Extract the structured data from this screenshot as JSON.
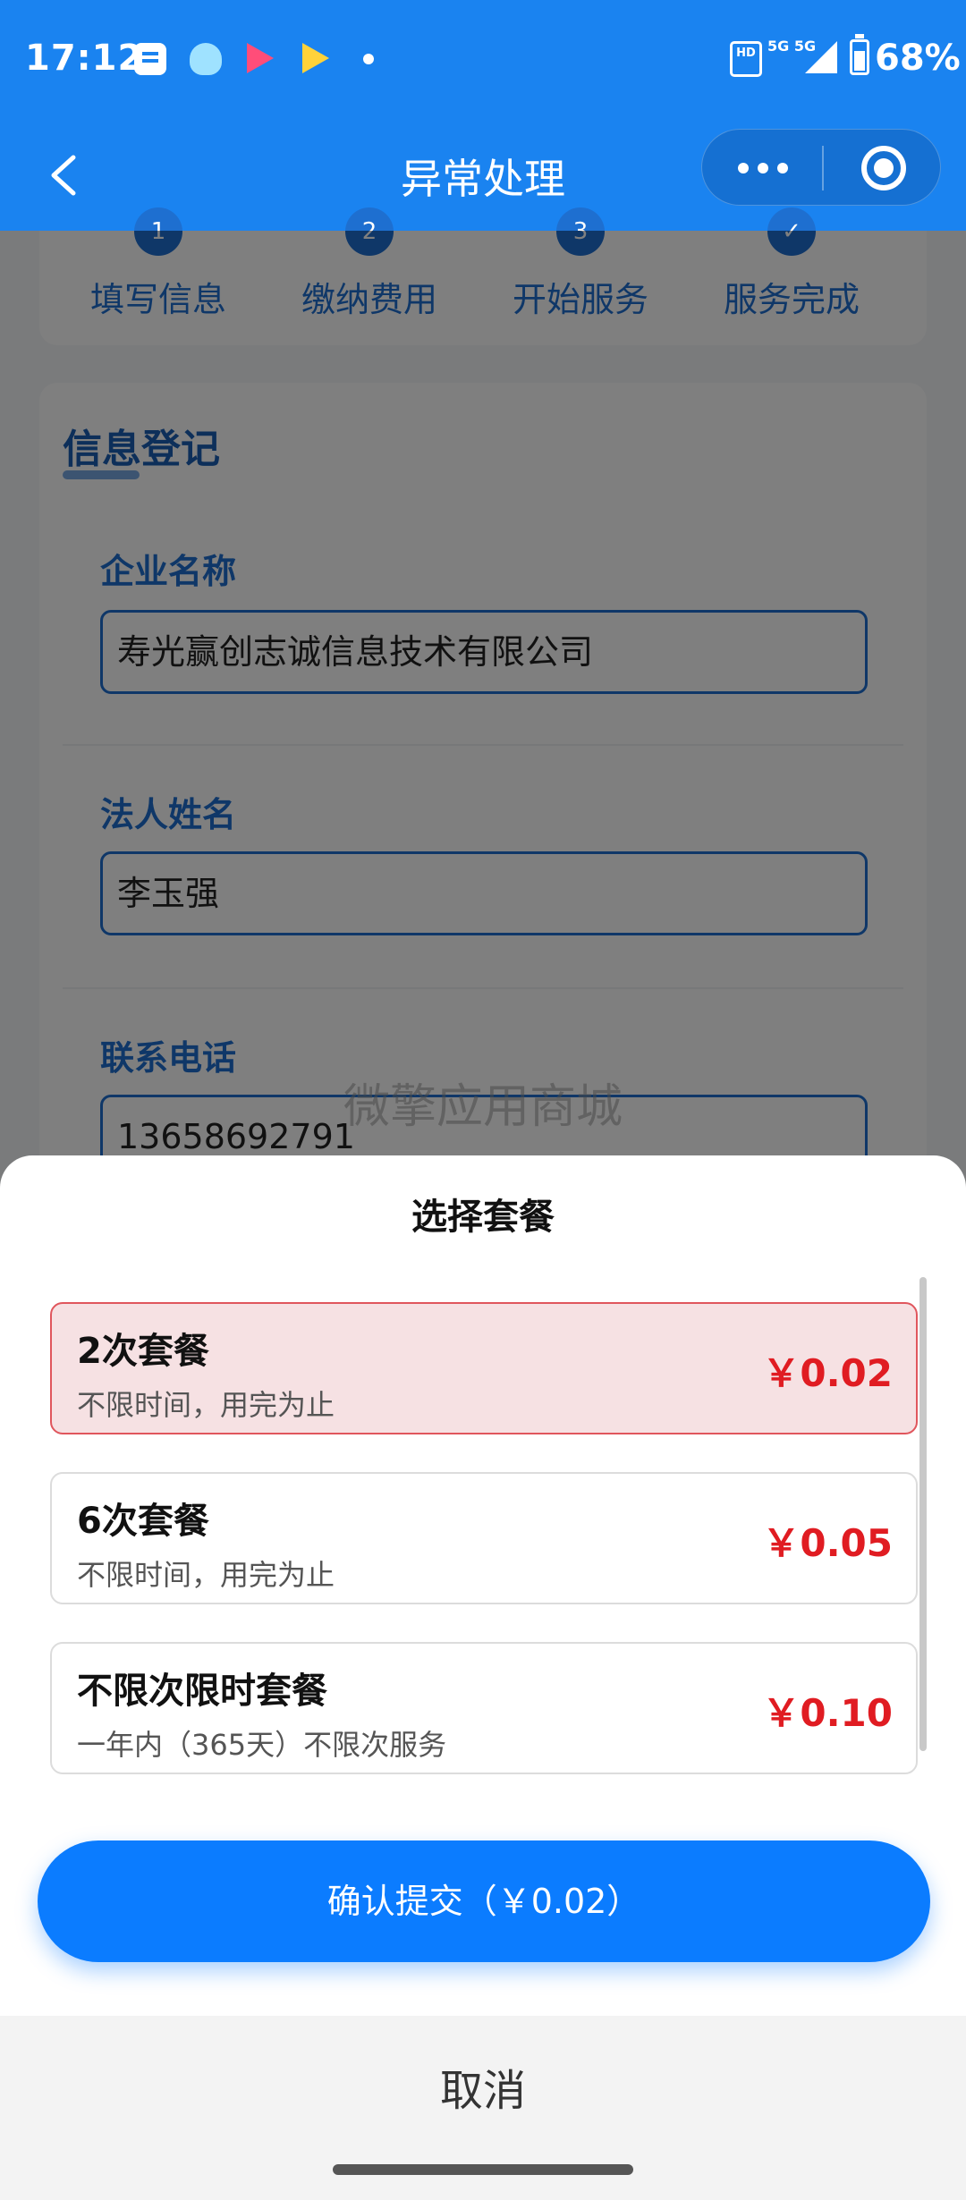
{
  "status_bar": {
    "time": "17:12",
    "hd_label": "HD",
    "network": "5G 5G",
    "battery": "68%",
    "notification_icons": [
      "message-icon",
      "qq-icon",
      "video-app-icon",
      "video-app-icon",
      "dot-icon"
    ]
  },
  "nav": {
    "title": "异常处理",
    "back_icon": "chevron-left-icon",
    "more_icon": "more-dots-icon",
    "close_icon": "target-icon"
  },
  "steps": [
    {
      "num": "1",
      "label": "填写信息"
    },
    {
      "num": "2",
      "label": "缴纳费用"
    },
    {
      "num": "3",
      "label": "开始服务"
    },
    {
      "num": "✓",
      "label": "服务完成"
    }
  ],
  "form": {
    "section_title": "信息登记",
    "company_label": "企业名称",
    "company_value": "寿光赢创志诚信息技术有限公司",
    "legal_label": "法人姓名",
    "legal_value": "李玉强",
    "phone_label": "联系电话",
    "phone_value": "13658692791"
  },
  "watermark": "微擎应用商城",
  "sheet": {
    "title": "选择套餐",
    "plans": [
      {
        "name": "2次套餐",
        "desc": "不限时间，用完为止",
        "price": "￥0.02",
        "selected": true
      },
      {
        "name": "6次套餐",
        "desc": "不限时间，用完为止",
        "price": "￥0.05",
        "selected": false
      },
      {
        "name": "不限次限时套餐",
        "desc": "一年内（365天）不限次服务",
        "price": "￥0.10",
        "selected": false
      }
    ],
    "confirm_label": "确认提交（￥0.02）",
    "cancel_label": "取消"
  },
  "colors": {
    "brand_blue": "#1a83f0",
    "button_blue": "#0b7cff",
    "price_red": "#e01c22",
    "selected_bg": "#f6e1e3"
  }
}
